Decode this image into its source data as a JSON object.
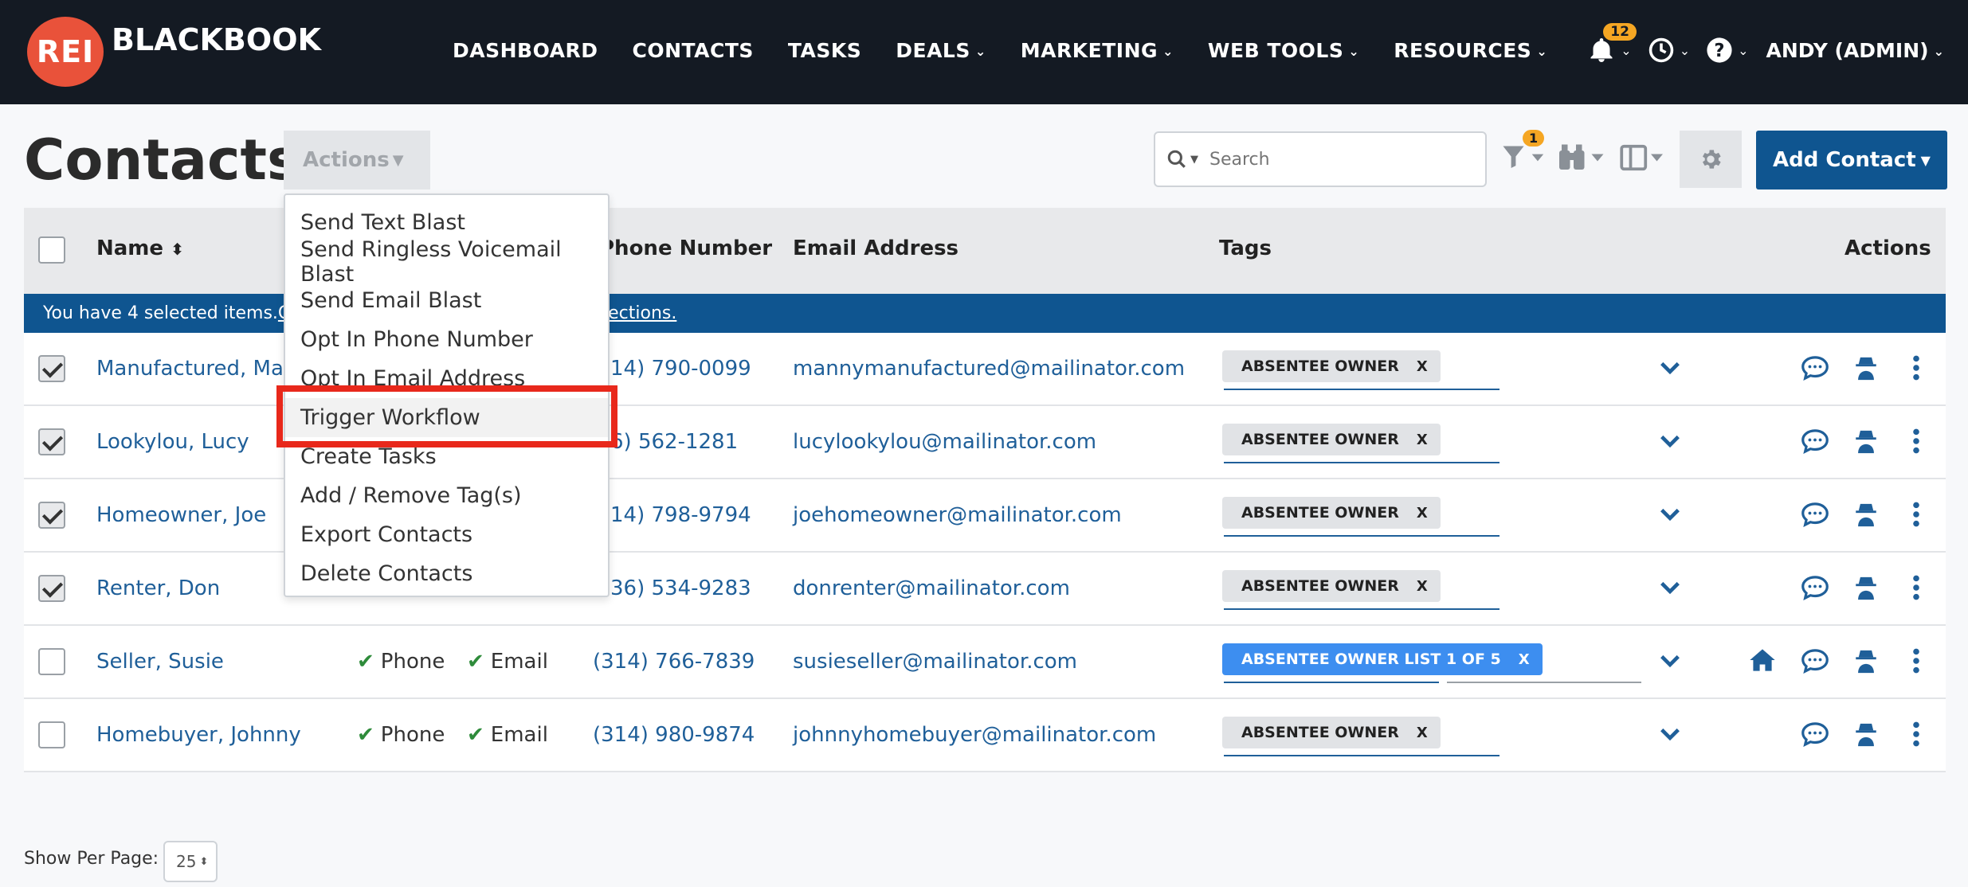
{
  "brand": {
    "logo_mark": "REI",
    "logo_text": "BLACKBOOK"
  },
  "nav": {
    "items": [
      {
        "label": "DASHBOARD",
        "has_caret": false
      },
      {
        "label": "CONTACTS",
        "has_caret": false
      },
      {
        "label": "TASKS",
        "has_caret": false
      },
      {
        "label": "DEALS",
        "has_caret": true
      },
      {
        "label": "MARKETING",
        "has_caret": true
      },
      {
        "label": "WEB TOOLS",
        "has_caret": true
      },
      {
        "label": "RESOURCES",
        "has_caret": true
      }
    ],
    "notification_count": "12",
    "user_label": "ANDY (ADMIN)"
  },
  "page": {
    "title": "Contacts",
    "actions_label": "Actions",
    "search_placeholder": "Search",
    "filter_count": "1",
    "add_contact_label": "Add Contact"
  },
  "table": {
    "headers": {
      "name": "Name",
      "phone": "Phone Number",
      "email": "Email Address",
      "tags": "Tags",
      "actions": "Actions"
    },
    "selection_banner": {
      "text": "You have 4 selected items. ",
      "link_start": "Cli",
      "link_end": "lections."
    },
    "rows": [
      {
        "name": "Manufactured, Mann",
        "checked": true,
        "phone_ok": "",
        "email_ok": "",
        "phone": "14) 790-0099",
        "email": "mannymanufactured@mailinator.com",
        "tag": "ABSENTEE OWNER",
        "tag_style": "gray",
        "home_icon": false
      },
      {
        "name": "Lookylou, Lucy",
        "checked": true,
        "phone_ok": "",
        "email_ok": "",
        "phone": "6) 562-1281",
        "email": "lucylookylou@mailinator.com",
        "tag": "ABSENTEE OWNER",
        "tag_style": "gray",
        "home_icon": false
      },
      {
        "name": "Homeowner, Joe",
        "checked": true,
        "phone_ok": "",
        "email_ok": "",
        "phone": "14) 798-9794",
        "email": "joehomeowner@mailinator.com",
        "tag": "ABSENTEE OWNER",
        "tag_style": "gray",
        "home_icon": false
      },
      {
        "name": "Renter, Don",
        "checked": true,
        "phone_ok": "",
        "email_ok": "",
        "phone": "36) 534-9283",
        "email": "donrenter@mailinator.com",
        "tag": "ABSENTEE OWNER",
        "tag_style": "gray",
        "home_icon": false
      },
      {
        "name": "Seller, Susie",
        "checked": false,
        "phone_ok": "Phone",
        "email_ok": "Email",
        "phone": "(314) 766-7839",
        "email": "susieseller@mailinator.com",
        "tag": "ABSENTEE OWNER LIST 1 OF 5",
        "tag_style": "blue",
        "home_icon": true
      },
      {
        "name": "Homebuyer, Johnny",
        "checked": false,
        "phone_ok": "Phone",
        "email_ok": "Email",
        "phone": "(314) 980-9874",
        "email": "johnnyhomebuyer@mailinator.com",
        "tag": "ABSENTEE OWNER",
        "tag_style": "gray",
        "home_icon": false
      }
    ]
  },
  "actions_menu": {
    "items": [
      "Send Text Blast",
      "Send Ringless Voicemail Blast",
      "Send Email Blast",
      "Opt In Phone Number",
      "Opt In Email Address",
      "Trigger Workflow",
      "Create Tasks",
      "Add / Remove Tag(s)",
      "Export Contacts",
      "Delete Contacts"
    ],
    "highlighted_index": 5
  },
  "footer": {
    "per_page_label": "Show Per Page:",
    "per_page_value": "25"
  },
  "colors": {
    "nav_bg": "#141a23",
    "primary": "#0f5590",
    "brand_red": "#e9523a",
    "badge": "#f5a623",
    "highlight": "#e8281b",
    "tag_blue": "#3d8ef0"
  }
}
